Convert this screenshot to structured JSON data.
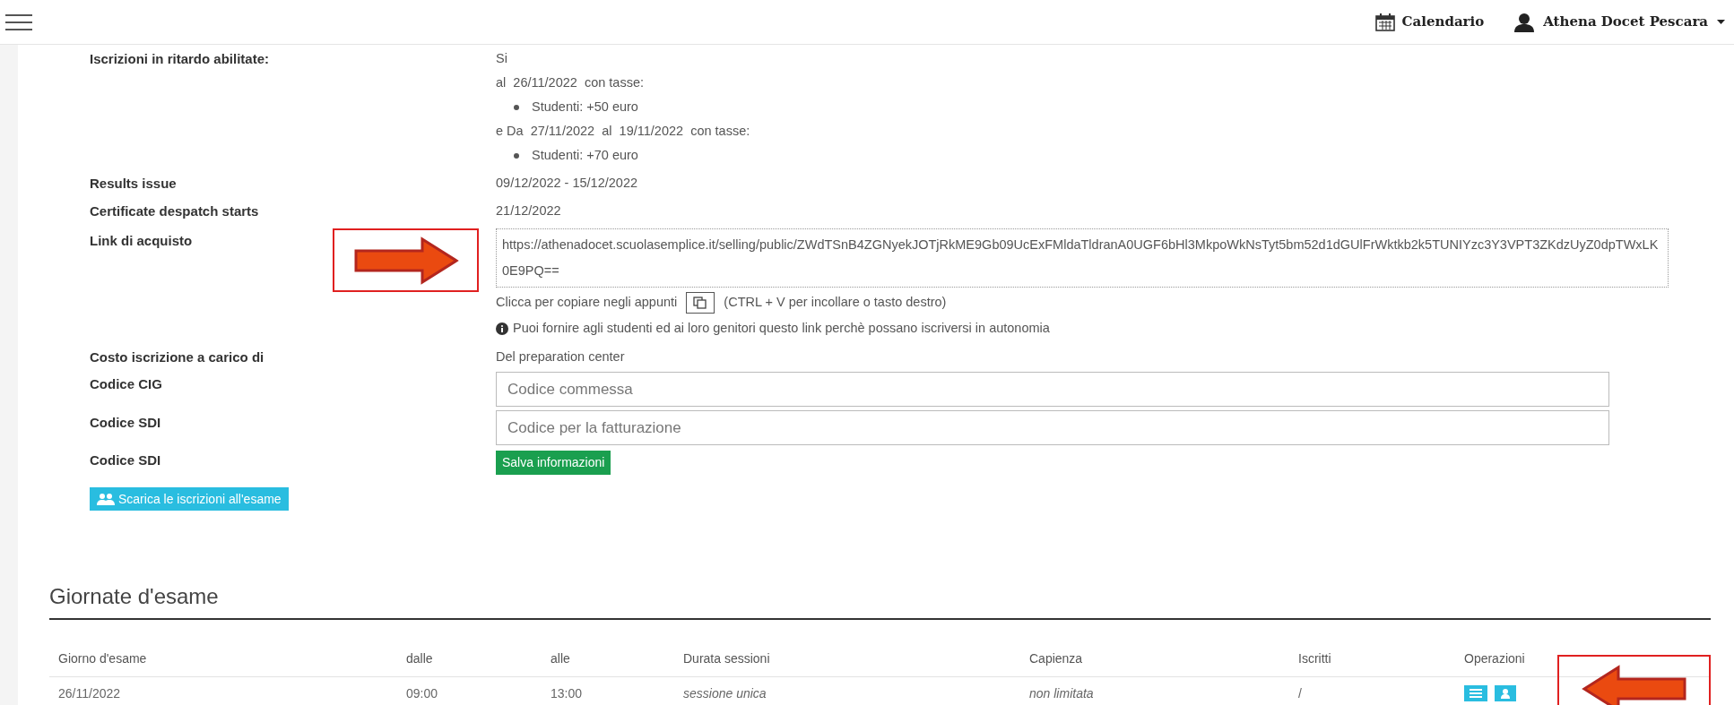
{
  "topbar": {
    "calendar_label": "Calendario",
    "user_name": "Athena Docet Pescara"
  },
  "details": [
    {
      "kind": "late",
      "label": "Iscrizioni in ritardo abilitate:",
      "value": "Si",
      "periods": [
        {
          "text": "al  26/11/2022  con tasse:",
          "fees": [
            "Studenti: +50 euro"
          ]
        },
        {
          "text": "e Da  27/11/2022  al  19/11/2022  con tasse:",
          "fees": [
            "Studenti: +70 euro"
          ]
        }
      ]
    },
    {
      "kind": "text",
      "label": "Results issue",
      "value": "09/12/2022 - 15/12/2022"
    },
    {
      "kind": "text",
      "label": "Certificate despatch starts",
      "value": "21/12/2022"
    },
    {
      "kind": "link",
      "label": "Link di acquisto",
      "value": "https://athenadocet.scuolasemplice.it/selling/public/ZWdTSnB4ZGNyekJOTjRkME9Gb09UcExFMldaTldranA0UGF6bHl3MkpoWkNsTyt5bm52d1dGUlFrWktkb2k5TUNIYzc3Y3VPT3ZKdzUyZ0dpTWxLK0E9PQ==",
      "copy_text": "Clicca per copiare negli appunti",
      "copy_hint": "(CTRL + V per incollare o tasto destro)",
      "info": "Puoi fornire agli studenti ed ai loro genitori questo link perchè possano iscriversi in autonomia"
    },
    {
      "kind": "text",
      "label": "Costo iscrizione a carico di",
      "value": "Del preparation center"
    },
    {
      "kind": "input",
      "label": "Codice CIG",
      "placeholder": "Codice commessa"
    },
    {
      "kind": "input",
      "label": "Codice SDI",
      "placeholder": "Codice per la fatturazione"
    },
    {
      "kind": "button",
      "label": "Codice SDI",
      "button": "Salva informazioni"
    }
  ],
  "download_button": "Scarica le iscrizioni all'esame",
  "exam_days": {
    "title": "Giornate d'esame",
    "columns": [
      "Giorno d'esame",
      "dalle",
      "alle",
      "Durata sessioni",
      "Capienza",
      "Iscritti",
      "Operazioni"
    ],
    "rows": [
      {
        "cells": [
          "26/11/2022",
          "09:00",
          "13:00",
          "sessione unica",
          "non limitata",
          "/"
        ]
      }
    ]
  }
}
